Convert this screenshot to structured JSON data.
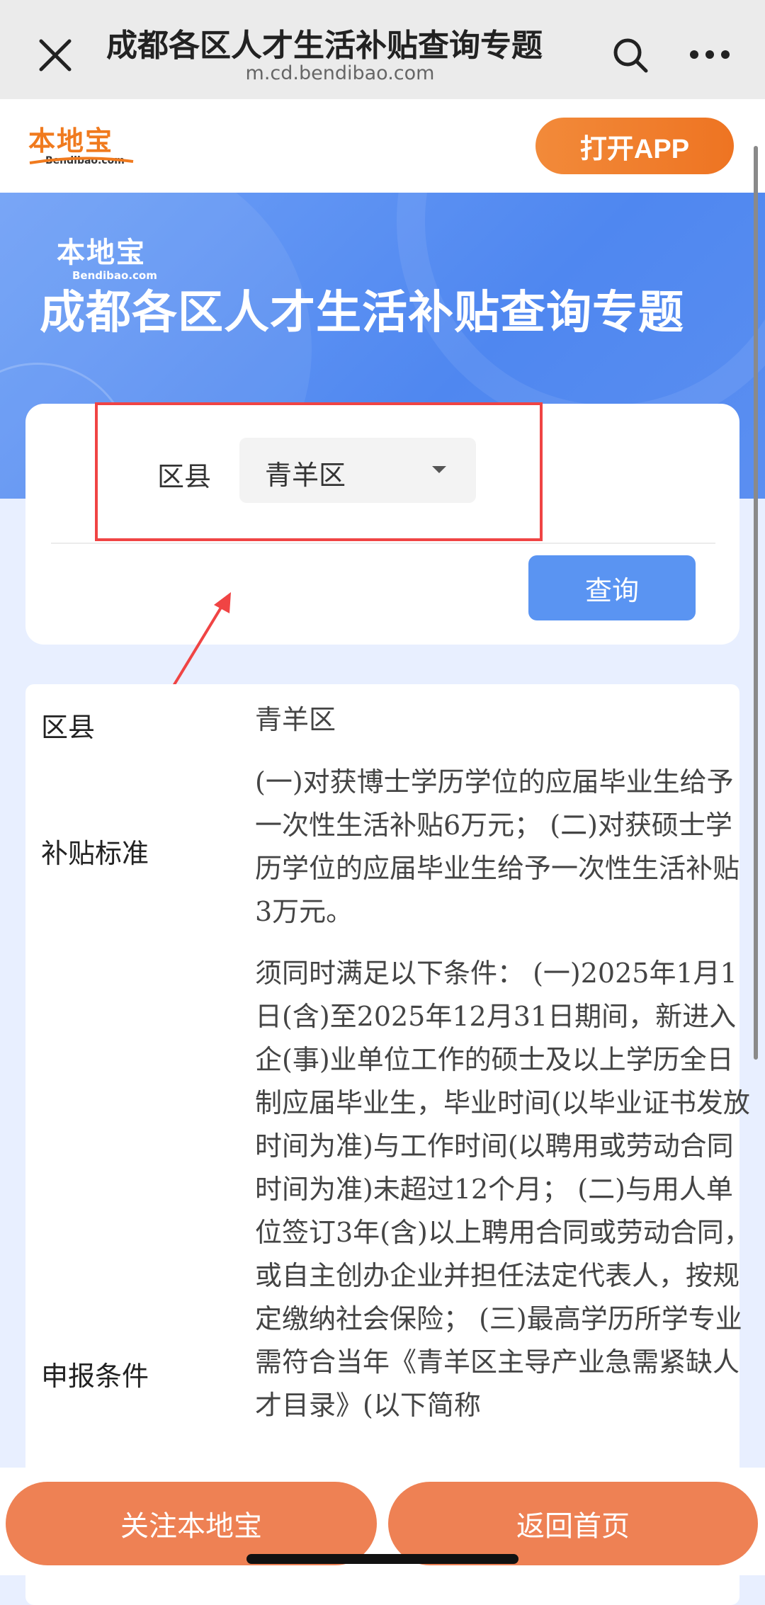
{
  "nav": {
    "title": "成都各区人才生活补贴查询专题",
    "url": "m.cd.bendibao.com",
    "close_icon": "close-icon",
    "search_icon": "search-icon",
    "more_icon": "more-icon"
  },
  "header": {
    "logo_cn": "本地宝",
    "logo_en": "Bendibao.com",
    "open_app": "打开APP"
  },
  "banner": {
    "logo_cn": "本地宝",
    "logo_en": "Bendibao.com",
    "title": "成都各区人才生活补贴查询专题"
  },
  "query": {
    "district_label": "区县",
    "district_value": "青羊区",
    "query_button": "查询"
  },
  "result": {
    "rows": [
      {
        "key": "区县",
        "value": "青羊区"
      },
      {
        "key": "补贴标准",
        "value": "(一)对获博士学历学位的应届毕业生给予一次性生活补贴6万元； (二)对获硕士学历学位的应届毕业生给予一次性生活补贴3万元。"
      },
      {
        "key": "申报条件",
        "value": "须同时满足以下条件： (一)2025年1月1日(含)至2025年12月31日期间，新进入企(事)业单位工作的硕士及以上学历全日制应届毕业生，毕业时间(以毕业证书发放时间为准)与工作时间(以聘用或劳动合同时间为准)未超过12个月； (二)与用人单位签订3年(含)以上聘用合同或劳动合同，或自主创办企业并担任法定代表人，按规定缴纳社会保险； (三)最高学历所学专业需符合当年《青羊区主导产业急需紧缺人才目录》(以下简称"
      }
    ]
  },
  "bottom": {
    "follow": "关注本地宝",
    "home": "返回首页"
  },
  "colors": {
    "accent_orange": "#ee7422",
    "banner_blue": "#4f87f0",
    "query_blue": "#5a94f2",
    "annotation_red": "#f04444"
  }
}
